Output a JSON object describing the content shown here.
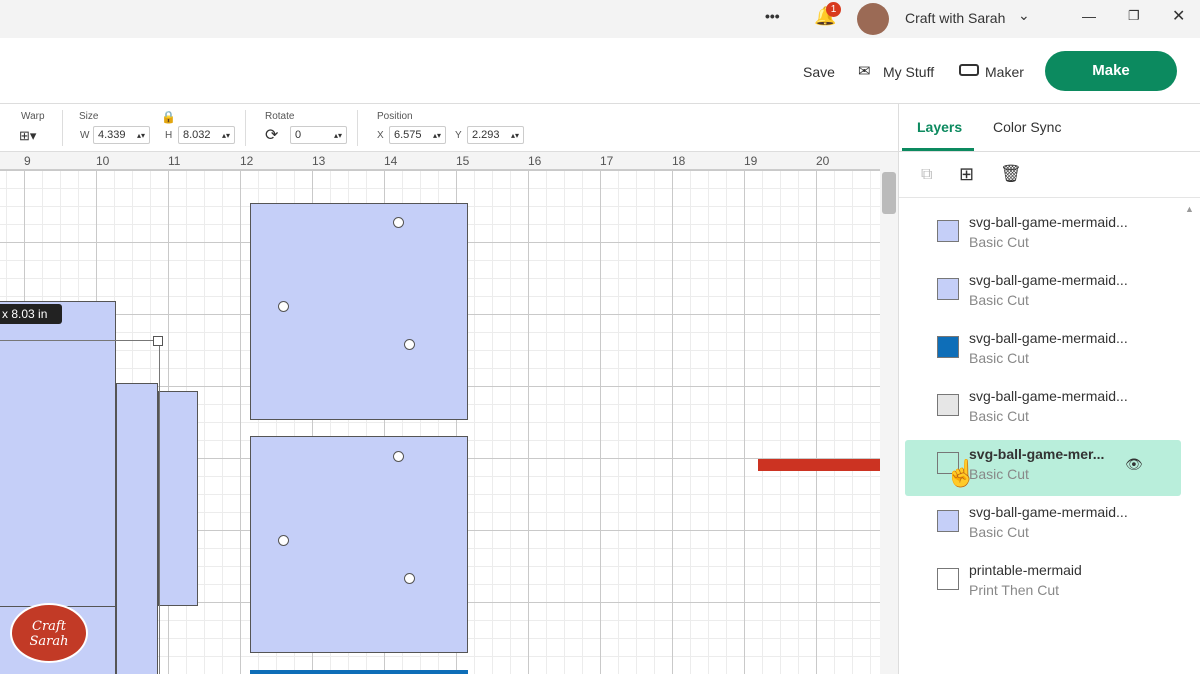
{
  "titlebar": {
    "more": "•••",
    "notification_count": "1",
    "account": "Craft with Sarah"
  },
  "header": {
    "save": "Save",
    "my_stuff": "My Stuff",
    "maker": "Maker",
    "make": "Make"
  },
  "toolbar": {
    "warp": "Warp",
    "size": "Size",
    "w_label": "W",
    "w": "4.339",
    "h_label": "H",
    "h": "8.032",
    "rotate": "Rotate",
    "rotate_value": "0",
    "position": "Position",
    "x_label": "X",
    "x": "6.575",
    "y_label": "Y",
    "y": "2.293"
  },
  "ruler": [
    "9",
    "10",
    "11",
    "12",
    "13",
    "14",
    "15",
    "16",
    "17",
    "18",
    "19",
    "20"
  ],
  "canvas": {
    "dimension_tooltip": "x 8.03  in"
  },
  "panel": {
    "tabs": [
      "Layers",
      "Color Sync"
    ],
    "layers": [
      {
        "name": "svg-ball-game-mermaid...",
        "type": "Basic Cut",
        "color": "#c5cff8"
      },
      {
        "name": "svg-ball-game-mermaid...",
        "type": "Basic Cut",
        "color": "#c5cff8"
      },
      {
        "name": "svg-ball-game-mermaid...",
        "type": "Basic Cut",
        "color": "#0e6eb8"
      },
      {
        "name": "svg-ball-game-mermaid...",
        "type": "Basic Cut",
        "color": "#e6e6e6"
      },
      {
        "name": "svg-ball-game-mer...",
        "type": "Basic Cut",
        "color": "#b9eedb"
      },
      {
        "name": "svg-ball-game-mermaid...",
        "type": "Basic Cut",
        "color": "#c5cff8"
      },
      {
        "name": "printable-mermaid",
        "type": "Print Then Cut",
        "color": "#ffffff"
      }
    ]
  },
  "logo": {
    "text": "Craft with Sarah"
  },
  "colors": {
    "accent": "#0c8a5f",
    "selected": "#b9eedb",
    "arrow": "#cc3322"
  }
}
